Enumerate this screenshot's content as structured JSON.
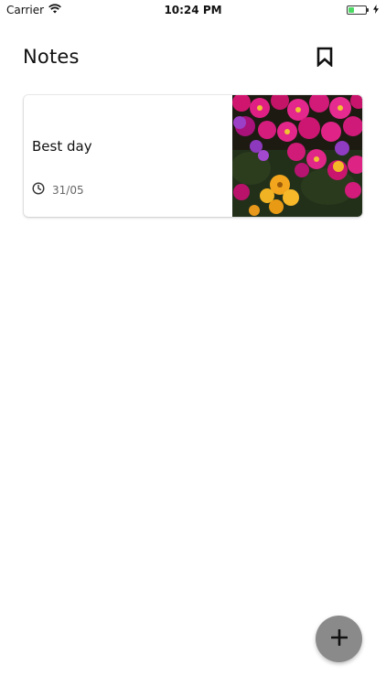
{
  "status_bar": {
    "carrier": "Carrier",
    "time": "10:24 PM",
    "battery_level": 0.35,
    "icons": [
      "wifi-icon",
      "battery-icon",
      "charging-bolt-icon"
    ]
  },
  "header": {
    "title": "Notes",
    "bookmark_icon": "bookmark-icon"
  },
  "notes": [
    {
      "title": "Best day",
      "date": "31/05",
      "date_icon": "clock-icon",
      "image": "flower-photo"
    }
  ],
  "fab": {
    "icon": "plus-icon"
  },
  "colors": {
    "background": "#ffffff",
    "fab": "#8a8a8a",
    "battery_green": "#4cd964",
    "date_text": "#666666"
  }
}
